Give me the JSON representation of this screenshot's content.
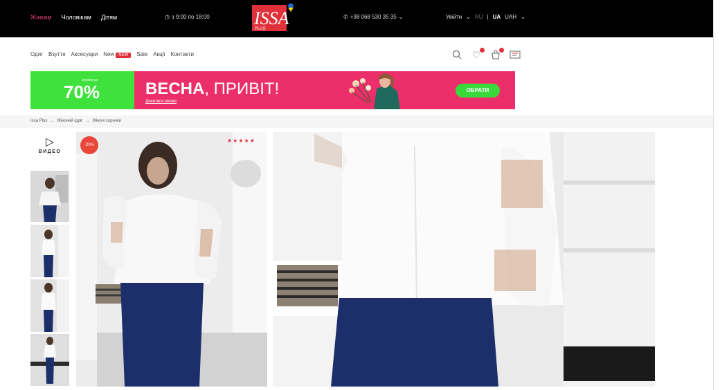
{
  "top_nav": {
    "women": "Жінкам",
    "men": "Чоловікам",
    "kids": "Дітям"
  },
  "hours": "з 9:00 по 18:00",
  "phone": "+38 068 530 35 35",
  "logo": {
    "text": "ISSA",
    "plus": "PLUS"
  },
  "account": {
    "login": "Увійти",
    "lang_ru": "RU",
    "lang_ua": "UA",
    "currency": "UAH"
  },
  "menu": [
    "Одяг",
    "Взуття",
    "Аксесуари",
    "New",
    "Sale",
    "Акції",
    "Контакти"
  ],
  "menu_badge": "NEW",
  "banner": {
    "small": "знижки до",
    "percent": "70%",
    "title_bold": "ВЕСНА",
    "title_rest": ", ПРИВІТ!",
    "subtitle": "Дивитися умови",
    "button": "ОБРАТИ"
  },
  "breadcrumbs": [
    "Issa Plus",
    "→",
    "Жіночий одяг",
    "→",
    "Жіночі сорочки"
  ],
  "video_label": "ВИДЕО",
  "product": {
    "sale_badge": "-20%",
    "stars": "★★★★★"
  },
  "colors": {
    "accent_pink": "#ec2f6a",
    "accent_green": "#3fe13c",
    "sale_red": "#e0313a"
  }
}
